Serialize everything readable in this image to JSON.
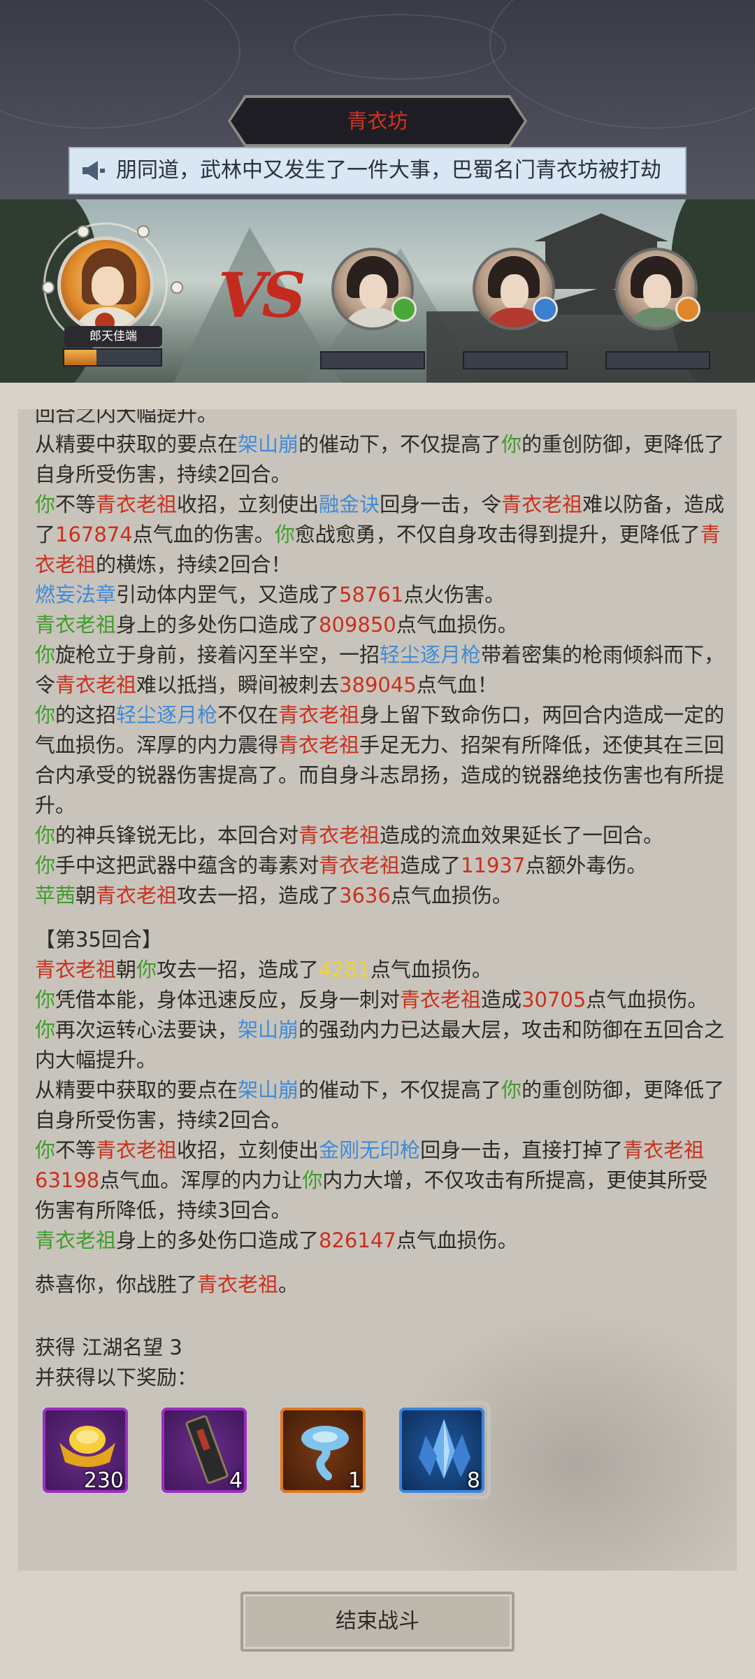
{
  "header": {
    "title": "青衣坊",
    "notice": "朋同道，武林中又发生了一件大事，巴蜀名门青衣坊被打劫"
  },
  "player": {
    "name": "郎天佳端",
    "hp_fraction": 0.33
  },
  "enemies": [
    {
      "badge_color": "#4aa83a"
    },
    {
      "badge_color": "#3b7fd0"
    },
    {
      "badge_color": "#e0862a"
    }
  ],
  "vs_text": "VS",
  "log": [
    [
      {
        "t": "回合之内大幅提升。"
      }
    ],
    [
      {
        "t": "从精要中获取的要点在"
      },
      {
        "t": "架山崩",
        "c": "b"
      },
      {
        "t": "的催动下，不仅提高了"
      },
      {
        "t": "你",
        "c": "g"
      },
      {
        "t": "的重创防御，更降低了自身所受伤害，持续2回合。"
      }
    ],
    [
      {
        "t": "你",
        "c": "g"
      },
      {
        "t": "不等"
      },
      {
        "t": "青衣老祖",
        "c": "r"
      },
      {
        "t": "收招，立刻使出"
      },
      {
        "t": "融金诀",
        "c": "b"
      },
      {
        "t": "回身一击，令"
      },
      {
        "t": "青衣老祖",
        "c": "r"
      },
      {
        "t": "难以防备，造成了"
      },
      {
        "t": "167874",
        "c": "r"
      },
      {
        "t": "点气血的伤害。"
      },
      {
        "t": "你",
        "c": "g"
      },
      {
        "t": "愈战愈勇，不仅自身攻击得到提升，更降低了"
      },
      {
        "t": "青衣老祖",
        "c": "r"
      },
      {
        "t": "的横炼，持续2回合！"
      }
    ],
    [
      {
        "t": "燃妄法章",
        "c": "b"
      },
      {
        "t": "引动体内罡气，又造成了"
      },
      {
        "t": "58761",
        "c": "r"
      },
      {
        "t": "点火伤害。"
      }
    ],
    [
      {
        "t": "青衣老祖",
        "c": "g"
      },
      {
        "t": "身上的多处伤口造成了"
      },
      {
        "t": "809850",
        "c": "r"
      },
      {
        "t": "点气血损伤。"
      }
    ],
    [
      {
        "t": "你",
        "c": "g"
      },
      {
        "t": "旋枪立于身前，接着闪至半空，一招"
      },
      {
        "t": "轻尘逐月枪",
        "c": "b"
      },
      {
        "t": "带着密集的枪雨倾斜而下，令"
      },
      {
        "t": "青衣老祖",
        "c": "r"
      },
      {
        "t": "难以抵挡，瞬间被刺去"
      },
      {
        "t": "389045",
        "c": "r"
      },
      {
        "t": "点气血！"
      }
    ],
    [
      {
        "t": "你",
        "c": "g"
      },
      {
        "t": "的这招"
      },
      {
        "t": "轻尘逐月枪",
        "c": "b"
      },
      {
        "t": "不仅在"
      },
      {
        "t": "青衣老祖",
        "c": "r"
      },
      {
        "t": "身上留下致命伤口，两回合内造成一定的气血损伤。浑厚的内力震得"
      },
      {
        "t": "青衣老祖",
        "c": "r"
      },
      {
        "t": "手足无力、招架有所降低，还使其在三回合内承受的锐器伤害提高了。而自身斗志昂扬，造成的锐器绝技伤害也有所提升。"
      }
    ],
    [
      {
        "t": "你",
        "c": "g"
      },
      {
        "t": "的神兵锋锐无比，本回合对"
      },
      {
        "t": "青衣老祖",
        "c": "r"
      },
      {
        "t": "造成的流血效果延长了一回合。"
      }
    ],
    [
      {
        "t": "你",
        "c": "g"
      },
      {
        "t": "手中这把武器中蕴含的毒素对"
      },
      {
        "t": "青衣老祖",
        "c": "r"
      },
      {
        "t": "造成了"
      },
      {
        "t": "11937",
        "c": "r"
      },
      {
        "t": "点额外毒伤。"
      }
    ],
    [
      {
        "t": "苹茜",
        "c": "g"
      },
      {
        "t": "朝"
      },
      {
        "t": "青衣老祖",
        "c": "r"
      },
      {
        "t": "攻去一招，造成了"
      },
      {
        "t": "3636",
        "c": "r"
      },
      {
        "t": "点气血损伤。"
      }
    ],
    [
      {
        "t": "【第35回合】"
      }
    ],
    [
      {
        "t": "青衣老祖",
        "c": "r"
      },
      {
        "t": "朝"
      },
      {
        "t": "你",
        "c": "g"
      },
      {
        "t": "攻去一招，造成了"
      },
      {
        "t": "4281",
        "c": "y"
      },
      {
        "t": "点气血损伤。"
      }
    ],
    [
      {
        "t": "你",
        "c": "g"
      },
      {
        "t": "凭借本能，身体迅速反应，反身一刺对"
      },
      {
        "t": "青衣老祖",
        "c": "r"
      },
      {
        "t": "造成"
      },
      {
        "t": "30705",
        "c": "r"
      },
      {
        "t": "点气血损伤。"
      }
    ],
    [
      {
        "t": "你",
        "c": "g"
      },
      {
        "t": "再次运转心法要诀，"
      },
      {
        "t": "架山崩",
        "c": "b"
      },
      {
        "t": "的强劲内力已达最大层，攻击和防御在五回合之内大幅提升。"
      }
    ],
    [
      {
        "t": "从精要中获取的要点在"
      },
      {
        "t": "架山崩",
        "c": "b"
      },
      {
        "t": "的催动下，不仅提高了"
      },
      {
        "t": "你",
        "c": "g"
      },
      {
        "t": "的重创防御，更降低了自身所受伤害，持续2回合。"
      }
    ],
    [
      {
        "t": "你",
        "c": "g"
      },
      {
        "t": "不等"
      },
      {
        "t": "青衣老祖",
        "c": "r"
      },
      {
        "t": "收招，立刻使出"
      },
      {
        "t": "金刚无印枪",
        "c": "b"
      },
      {
        "t": "回身一击，直接打掉了"
      },
      {
        "t": "青衣老祖",
        "c": "r"
      },
      {
        "t": "63198",
        "c": "r"
      },
      {
        "t": "点气血。浑厚的内力让"
      },
      {
        "t": "你",
        "c": "g"
      },
      {
        "t": "内力大增，不仅攻击有所提高，更使其所受伤害有所降低，持续3回合。"
      }
    ],
    [
      {
        "t": "青衣老祖",
        "c": "g"
      },
      {
        "t": "身上的多处伤口造成了"
      },
      {
        "t": "826147",
        "c": "r"
      },
      {
        "t": "点气血损伤。"
      }
    ],
    [
      {
        "t": "恭喜你，你战胜了"
      },
      {
        "t": "青衣老祖",
        "c": "r"
      },
      {
        "t": "。"
      }
    ]
  ],
  "rewards": {
    "line1": "获得 江湖名望 3",
    "line2": "并获得以下奖励：",
    "items": [
      {
        "icon": "gold-ingot-icon",
        "qty": "230",
        "frame": "#9b2fc4"
      },
      {
        "icon": "scroll-book-icon",
        "qty": "4",
        "frame": "#9b2fc4"
      },
      {
        "icon": "blue-spirit-icon",
        "qty": "1",
        "frame": "#e2781d"
      },
      {
        "icon": "blue-crystal-icon",
        "qty": "8",
        "frame": "#3a86de"
      }
    ]
  },
  "end_button": "结束战斗"
}
